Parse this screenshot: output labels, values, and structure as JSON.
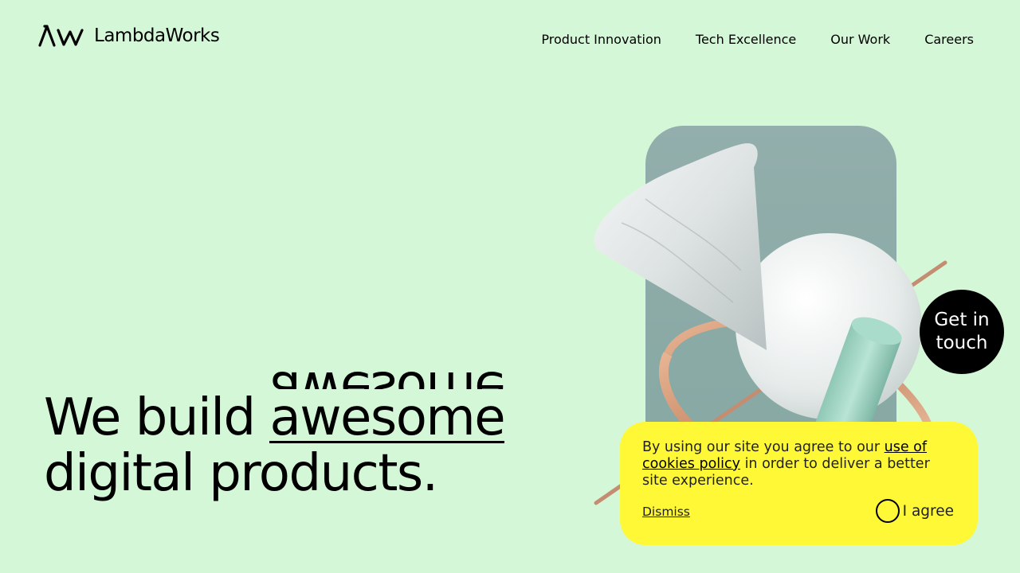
{
  "brand": {
    "name": "LambdaWorks",
    "logo_icon": "lambda-w-icon"
  },
  "nav": {
    "items": [
      {
        "label": "Product Innovation"
      },
      {
        "label": "Tech Excellence"
      },
      {
        "label": "Our Work"
      },
      {
        "label": "Careers"
      }
    ]
  },
  "hero": {
    "line1_prefix": "We build",
    "highlight_word": "awesome",
    "line2": "digital products."
  },
  "cta": {
    "label": "Get in touch"
  },
  "cookie_banner": {
    "text_before": "By using our site you agree to our ",
    "policy_link": "use of cookies policy",
    "text_after": " in order to deliver a better site experience.",
    "dismiss_label": "Dismiss",
    "agree_label": "I agree"
  },
  "colors": {
    "background": "#d4f8d7",
    "cookie_banner": "#fff836",
    "cta_background": "#000000",
    "card": "#8faaa8"
  }
}
